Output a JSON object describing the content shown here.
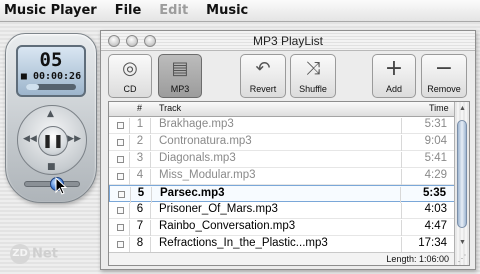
{
  "menubar": {
    "app_name": "Music Player",
    "items": [
      {
        "label": "File",
        "enabled": true
      },
      {
        "label": "Edit",
        "enabled": false
      },
      {
        "label": "Music",
        "enabled": true
      }
    ]
  },
  "player": {
    "lcd_track": "05",
    "lcd_time": "00:00:26",
    "lcd_progress": 0.25,
    "volume_level": 0.6,
    "play_state": "paused",
    "icons": [
      "stop-icon",
      "prev-icon",
      "next-icon",
      "volume-icon",
      "pause-icon"
    ]
  },
  "watermark": {
    "zd": "ZD",
    "net": "Net"
  },
  "window": {
    "title": "MP3 PlayList",
    "toolbar": [
      {
        "label": "CD",
        "icon": "cd-icon",
        "selected": false
      },
      {
        "label": "MP3",
        "icon": "mp3-file-icon",
        "selected": true
      },
      {
        "label": "Revert",
        "icon": "revert-icon",
        "selected": false
      },
      {
        "label": "Shuffle",
        "icon": "shuffle-icon",
        "selected": false
      },
      {
        "label": "Add",
        "icon": "plus-icon",
        "selected": false
      },
      {
        "label": "Remove",
        "icon": "minus-icon",
        "selected": false
      }
    ],
    "columns": {
      "num": "#",
      "track": "Track",
      "time": "Time"
    },
    "tracks": [
      {
        "num": "1",
        "name": "Brakhage.mp3",
        "time": "5:31",
        "state": "played"
      },
      {
        "num": "2",
        "name": "Contronatura.mp3",
        "time": "9:04",
        "state": "played"
      },
      {
        "num": "3",
        "name": "Diagonals.mp3",
        "time": "5:41",
        "state": "played"
      },
      {
        "num": "4",
        "name": "Miss_Modular.mp3",
        "time": "4:29",
        "state": "played"
      },
      {
        "num": "5",
        "name": "Parsec.mp3",
        "time": "5:35",
        "state": "current"
      },
      {
        "num": "6",
        "name": "Prisoner_Of_Mars.mp3",
        "time": "4:03",
        "state": "queued"
      },
      {
        "num": "7",
        "name": "Rainbo_Conversation.mp3",
        "time": "4:47",
        "state": "queued"
      },
      {
        "num": "8",
        "name": "Refractions_In_the_Plastic...mp3",
        "time": "17:34",
        "state": "queued"
      }
    ],
    "length_label": "Length:",
    "length_value": "1:06:00"
  },
  "colors": {
    "current_row_border": "#7aa7d8",
    "played_text": "#8a8a8a",
    "volume_knob": "#2f6fd0"
  }
}
